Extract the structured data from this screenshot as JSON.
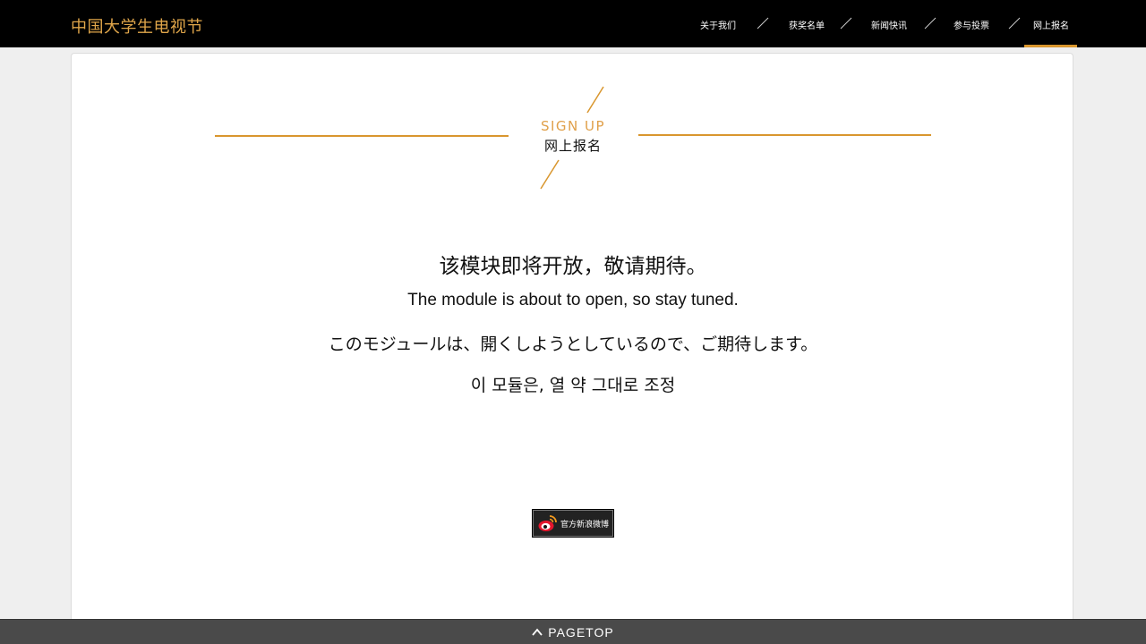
{
  "site": {
    "logo_text": "中国大学生电视节"
  },
  "nav": {
    "items": [
      {
        "label": "关于我们"
      },
      {
        "label": "获奖名单"
      },
      {
        "label": "新闻快讯"
      },
      {
        "label": "参与投票"
      },
      {
        "label": "网上报名"
      }
    ],
    "active_index": 4
  },
  "section": {
    "title_en": "SIGN UP",
    "title_cn": "网上报名"
  },
  "message": {
    "cn": "该模块即将开放，敬请期待。",
    "en": "The module is about to open, so stay tuned.",
    "jp": "このモジュールは、開くしようとしているので、ご期待します。",
    "kr": "이 모듈은, 열 약 그대로 조정"
  },
  "weibo": {
    "label": "官方新浪微博",
    "icon": "weibo-icon"
  },
  "footer": {
    "pagetop_label": "PAGETOP",
    "icon": "chevron-up-icon"
  },
  "colors": {
    "accent": "#d9962e",
    "topbar_bg": "#000000",
    "page_bg": "#efefef",
    "pagetop_bg": "#4a4a4a"
  }
}
